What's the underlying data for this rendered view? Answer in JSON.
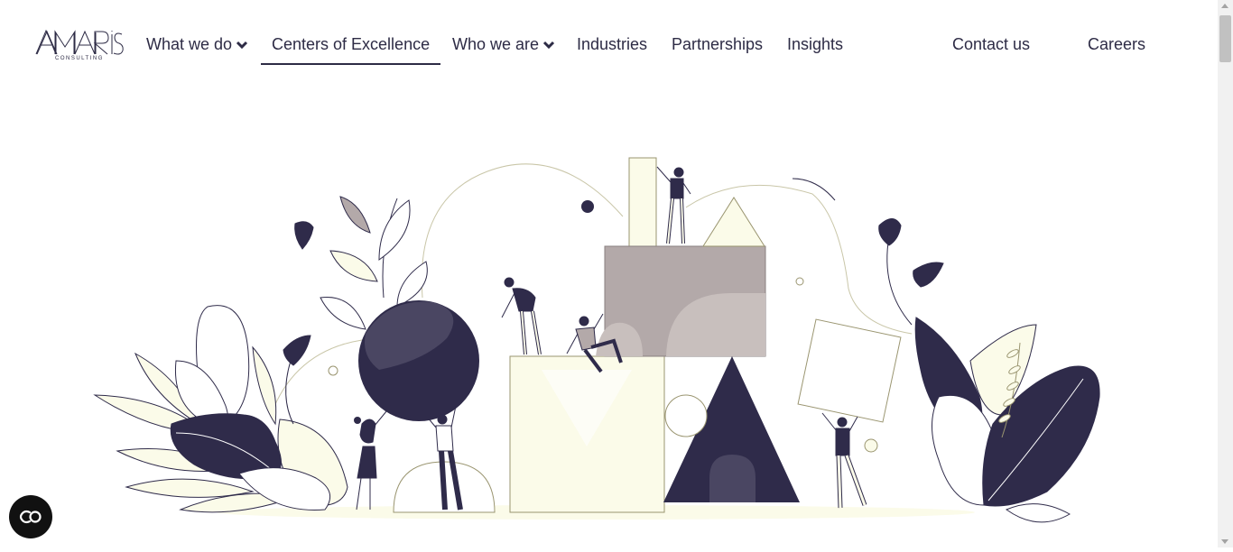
{
  "brand": {
    "name": "AMARIS",
    "tagline": "CONSULTING"
  },
  "nav": {
    "items": [
      {
        "label": "What we do",
        "has_dropdown": true,
        "active": false
      },
      {
        "label": "Centers of Excellence",
        "has_dropdown": false,
        "active": true
      },
      {
        "label": "Who we are",
        "has_dropdown": true,
        "active": false
      },
      {
        "label": "Industries",
        "has_dropdown": false,
        "active": false
      },
      {
        "label": "Partnerships",
        "has_dropdown": false,
        "active": false
      },
      {
        "label": "Insights",
        "has_dropdown": false,
        "active": false
      }
    ],
    "contact": "Contact us",
    "careers": "Careers"
  },
  "colors": {
    "text": "#2d2b45",
    "navy": "#2f2b4a",
    "cream": "#fbfbe9",
    "taupe": "#b3a9a9",
    "line": "#9a9570"
  }
}
